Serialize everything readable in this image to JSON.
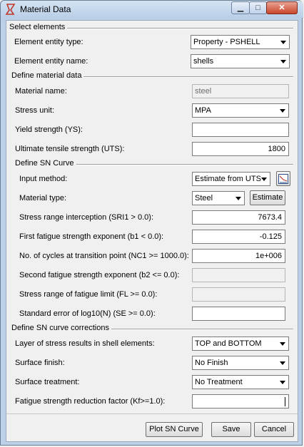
{
  "window": {
    "title": "Material Data"
  },
  "sections": {
    "select_elements": "Select elements",
    "define_material": "Define material data",
    "define_sn": "Define SN Curve",
    "define_corrections": "Define SN curve corrections"
  },
  "entity_type": {
    "label": "Element entity type:",
    "value": "Property - PSHELL"
  },
  "entity_name": {
    "label": "Element entity name:",
    "value": "shells"
  },
  "material_name": {
    "label": "Material name:",
    "value": "steel"
  },
  "stress_unit": {
    "label": "Stress unit:",
    "value": "MPA"
  },
  "yield_strength": {
    "label": "Yield strength (YS):",
    "value": ""
  },
  "uts": {
    "label": "Ultimate tensile strength (UTS):",
    "value": "1800"
  },
  "input_method": {
    "label": "Input method:",
    "value": "Estimate from UTS"
  },
  "material_type": {
    "label": "Material type:",
    "value": "Steel",
    "estimate_button": "Estimate"
  },
  "sri1": {
    "label": "Stress range interception (SRI1 > 0.0):",
    "value": "7673.4"
  },
  "b1": {
    "label": "First fatigue strength exponent (b1 < 0.0):",
    "value": "-0.125"
  },
  "nc1": {
    "label": "No. of cycles at transition point (NC1 >= 1000.0):",
    "value": "1e+006"
  },
  "b2": {
    "label": "Second fatigue strength exponent (b2 <= 0.0):",
    "value": ""
  },
  "fl": {
    "label": "Stress range of fatigue limit (FL >= 0.0):",
    "value": ""
  },
  "se": {
    "label": "Standard error of log10(N) (SE >= 0.0):",
    "value": ""
  },
  "layer": {
    "label": "Layer of stress results in shell elements:",
    "value": "TOP and BOTTOM"
  },
  "surface_finish": {
    "label": "Surface finish:",
    "value": "No Finish"
  },
  "surface_treatment": {
    "label": "Surface treatment:",
    "value": "No Treatment"
  },
  "kf": {
    "label": "Fatigue strength reduction factor (Kf>=1.0):",
    "value": ""
  },
  "buttons": {
    "plot": "Plot SN Curve",
    "save": "Save",
    "cancel": "Cancel"
  },
  "icons": {
    "app": "material-data-icon",
    "chart": "chart-icon"
  },
  "colors": {
    "title_bg": "#bcd1e8",
    "close_button": "#c9462c"
  }
}
